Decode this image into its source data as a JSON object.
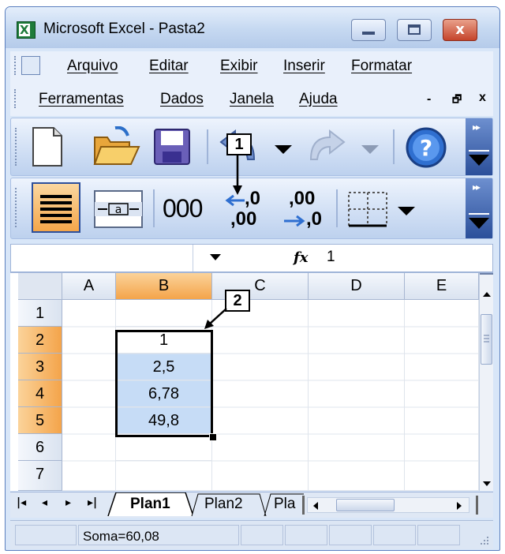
{
  "window": {
    "title": "Microsoft Excel - Pasta2",
    "close_symbol": "x"
  },
  "menu": {
    "items": [
      "Arquivo",
      "Editar",
      "Exibir",
      "Inserir",
      "Formatar",
      "Ferramentas",
      "Dados",
      "Janela",
      "Ajuda"
    ],
    "mdi_minimize": "-",
    "mdi_restore": "🗗",
    "mdi_close": "x"
  },
  "toolbar_standard": {
    "icons": [
      "new-document-icon",
      "open-folder-icon",
      "save-icon",
      "undo-icon",
      "redo-icon",
      "help-icon"
    ]
  },
  "toolbar_formatting": {
    "thousands_label": "000",
    "increase_decimal_top": ",0",
    "increase_decimal_bottom": ",00",
    "decrease_decimal_top": ",00",
    "decrease_decimal_bottom": ",0",
    "icons": [
      "align-center-icon",
      "merge-center-icon",
      "thousands-separator-icon",
      "increase-decimal-icon",
      "decrease-decimal-icon",
      "borders-icon"
    ]
  },
  "formula_bar": {
    "name_box": "",
    "fx_label": "fx",
    "value": "1"
  },
  "sheet": {
    "columns": [
      "A",
      "B",
      "C",
      "D",
      "E"
    ],
    "selected_column": "B",
    "rows": [
      "1",
      "2",
      "3",
      "4",
      "5",
      "6",
      "7"
    ],
    "selected_rows": [
      "2",
      "3",
      "4",
      "5"
    ],
    "cells": {
      "B2": "1",
      "B3": "2,5",
      "B4": "6,78",
      "B5": "49,8"
    }
  },
  "sheet_tabs": {
    "tabs": [
      "Plan1",
      "Plan2",
      "Pla"
    ],
    "active": "Plan1"
  },
  "status": {
    "sum": "Soma=60,08"
  },
  "callouts": [
    "1",
    "2"
  ],
  "colors": {
    "selection_fill": "#c6dcf6",
    "header_selected": "#f4a44a",
    "title_gradient": "#c5d8f1"
  }
}
